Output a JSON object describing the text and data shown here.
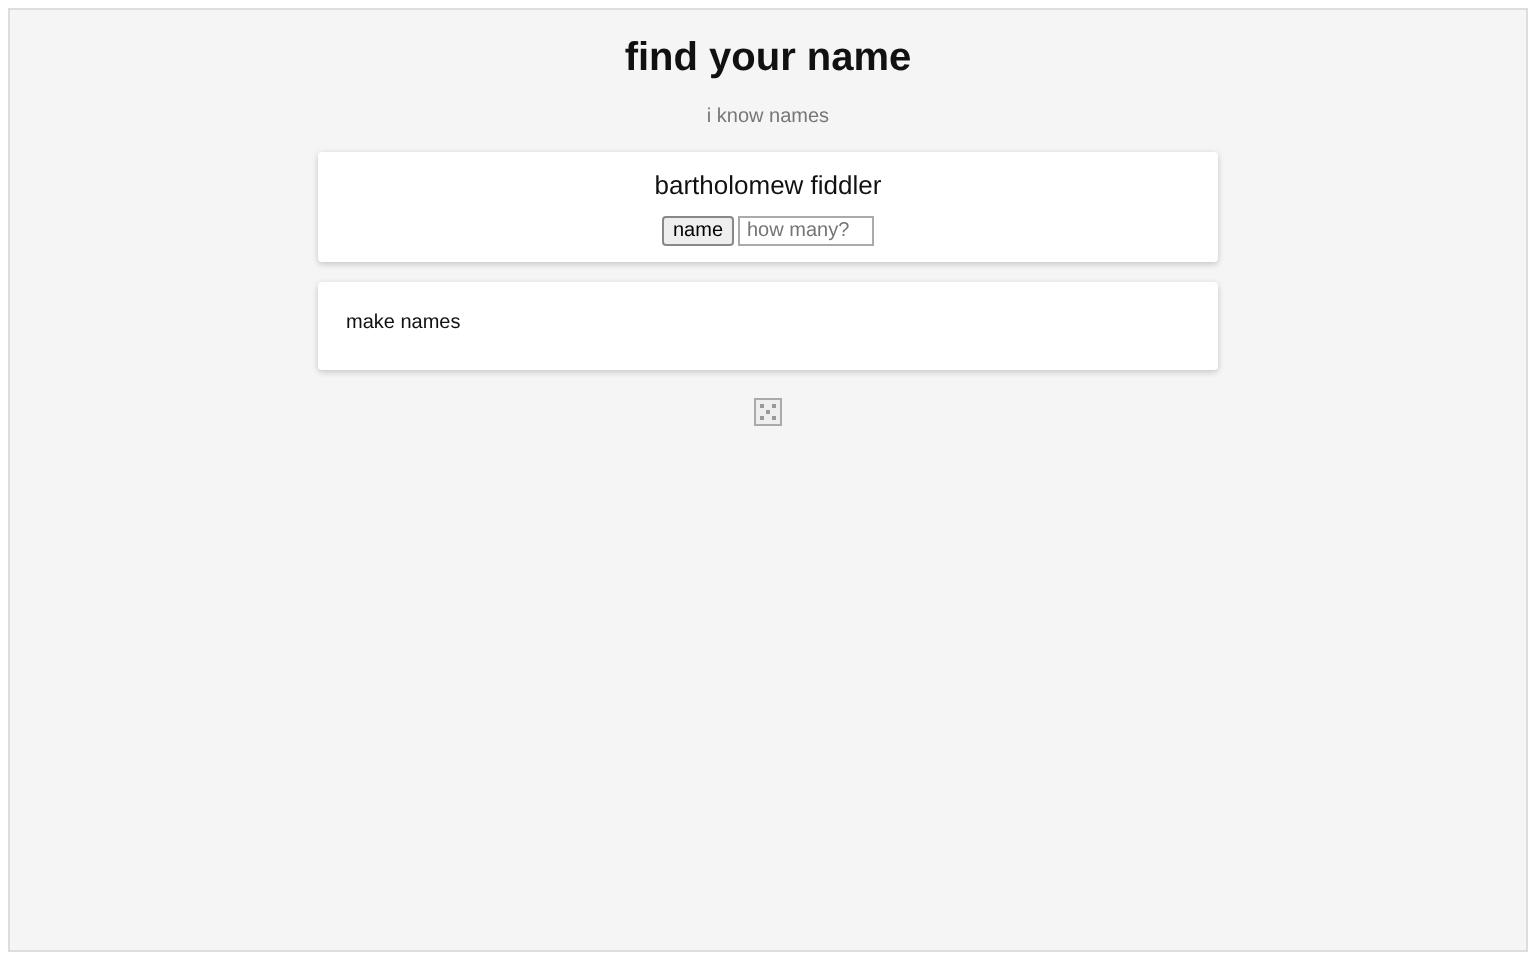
{
  "title": "find your name",
  "subtitle": "i know names",
  "generator": {
    "name": "bartholomew fiddler",
    "button": "name",
    "count": {
      "placeholder": "how many?"
    }
  },
  "make_names": {
    "label": "make names"
  }
}
